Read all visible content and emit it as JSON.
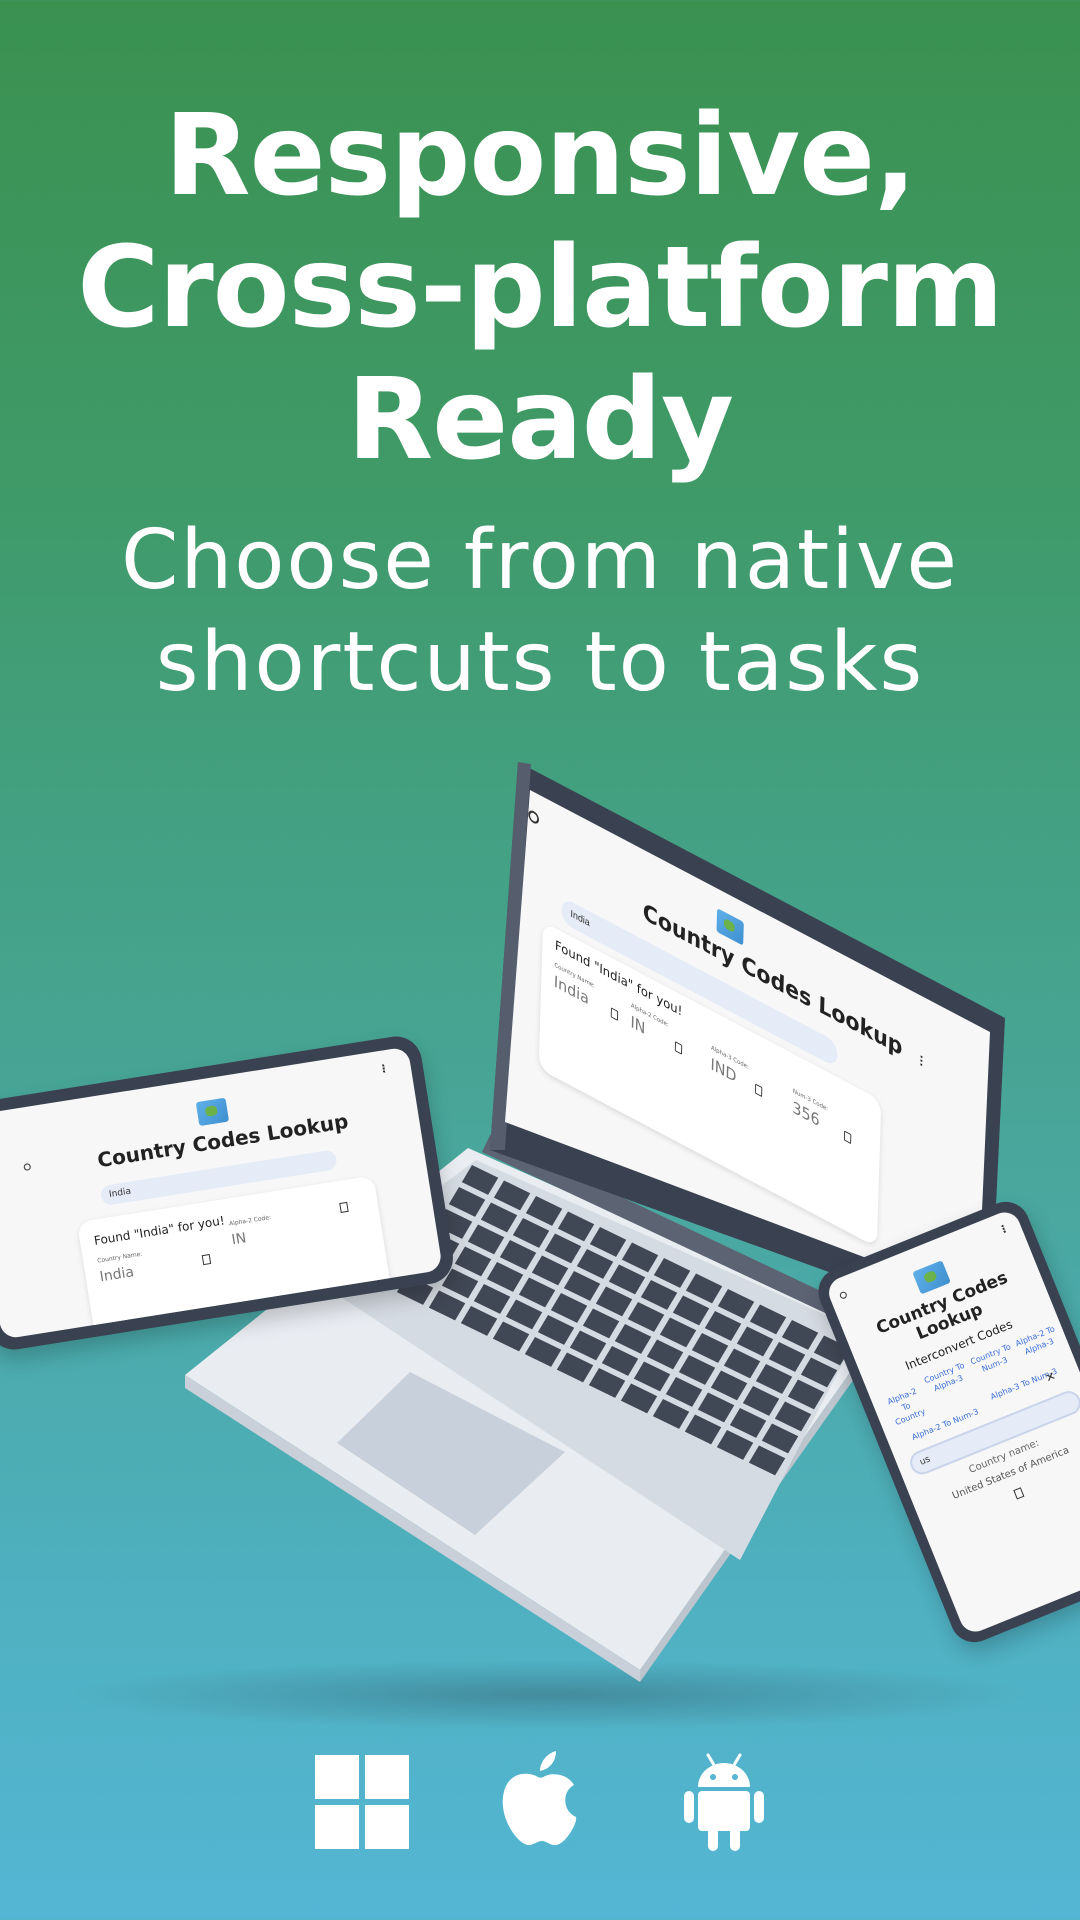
{
  "headline": [
    "Responsive,",
    "Cross-platform",
    "Ready"
  ],
  "subheadline": [
    "Choose from native",
    "shortcuts to tasks"
  ],
  "app": {
    "title": "Country Codes Lookup",
    "title_phone": [
      "Country Codes",
      "Lookup"
    ],
    "search_value": "India",
    "found_text": "Found \"India\" for you!",
    "fields": {
      "country_name_label": "Country Name:",
      "country_name_value": "India",
      "alpha2_label": "Alpha-2 Code:",
      "alpha2_value": "IN",
      "alpha3_label": "Alpha-3 Code:",
      "alpha3_value": "IND",
      "num3_label": "Num-3 Code:",
      "num3_value": "356"
    },
    "phone": {
      "section_title": "Interconvert Codes",
      "options": [
        "Alpha-2 To Country",
        "Country To Alpha-3",
        "Country To Num-3",
        "Alpha-2 To Alpha-3",
        "Alpha-2 To Num-3",
        "Alpha-3 To Num-3"
      ],
      "input_value": "us",
      "result_label": "Country name:",
      "result_value": "United States of America"
    }
  },
  "platforms": [
    "windows-icon",
    "apple-icon",
    "android-icon"
  ],
  "colors": {
    "bg_top": "#3a9150",
    "bg_bottom": "#55b6d4",
    "device_frame": "#3a4150",
    "screen_bg": "#f7f7f8",
    "search_bg": "#e5ebf7",
    "keyboard": "#414855",
    "laptop_body": "#e9edf2"
  }
}
